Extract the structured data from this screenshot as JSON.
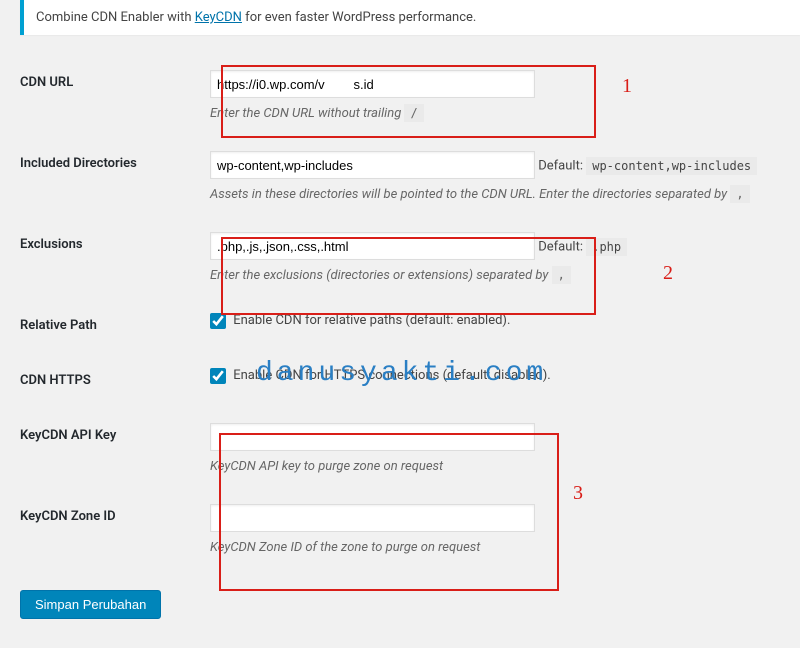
{
  "notice": {
    "prefix": "Combine CDN Enabler with ",
    "link_text": "KeyCDN",
    "suffix": " for even faster WordPress performance."
  },
  "fields": {
    "cdn_url": {
      "label": "CDN URL",
      "value": "https://i0.wp.com/v        s.id",
      "desc_prefix": "Enter the CDN URL without trailing ",
      "desc_code": "/"
    },
    "included_dirs": {
      "label": "Included Directories",
      "value": "wp-content,wp-includes",
      "default_label": "Default: ",
      "default_code": "wp-content,wp-includes",
      "desc_prefix": "Assets in these directories will be pointed to the CDN URL. Enter the directories separated by ",
      "desc_code": ","
    },
    "exclusions": {
      "label": "Exclusions",
      "value": ".php,.js,.json,.css,.html",
      "default_label": "Default: ",
      "default_code": ".php",
      "desc_prefix": "Enter the exclusions (directories or extensions) separated by ",
      "desc_code": ","
    },
    "relative_path": {
      "label": "Relative Path",
      "checkbox_label": "Enable CDN for relative paths (default: enabled)."
    },
    "cdn_https": {
      "label": "CDN HTTPS",
      "checkbox_label": "Enable CDN for HTTPS connections (default: disabled)."
    },
    "api_key": {
      "label": "KeyCDN API Key",
      "value": "",
      "desc": "KeyCDN API key to purge zone on request"
    },
    "zone_id": {
      "label": "KeyCDN Zone ID",
      "value": "",
      "desc": "KeyCDN Zone ID of the zone to purge on request"
    }
  },
  "submit_label": "Simpan Perubahan",
  "watermark": "danusyakti.com",
  "annotations": {
    "a1": "1",
    "a2": "2",
    "a3": "3"
  }
}
